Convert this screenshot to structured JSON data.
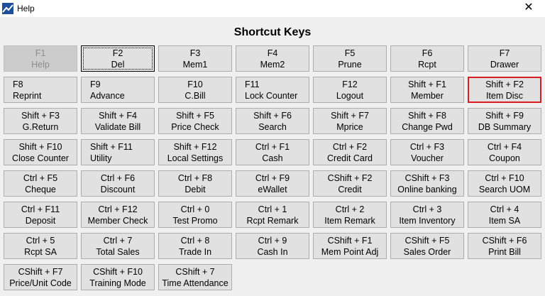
{
  "window": {
    "title": "Help",
    "close_glyph": "✕"
  },
  "heading": "Shortcut Keys",
  "keys": [
    {
      "line1": "F1",
      "line2": "Help",
      "align": "center",
      "state": "disabled"
    },
    {
      "line1": "F2",
      "line2": "Del",
      "align": "center",
      "state": "focused"
    },
    {
      "line1": "F3",
      "line2": "Mem1",
      "align": "center"
    },
    {
      "line1": "F4",
      "line2": "Mem2",
      "align": "center"
    },
    {
      "line1": "F5",
      "line2": "Prune",
      "align": "center"
    },
    {
      "line1": "F6",
      "line2": "Rcpt",
      "align": "center"
    },
    {
      "line1": "F7",
      "line2": "Drawer",
      "align": "center"
    },
    {
      "line1": "F8",
      "line2": "Reprint",
      "align": "left"
    },
    {
      "line1": "F9",
      "line2": "Advance",
      "align": "left"
    },
    {
      "line1": "F10",
      "line2": "C.Bill",
      "align": "center"
    },
    {
      "line1": "F11",
      "line2": "Lock Counter",
      "align": "left"
    },
    {
      "line1": "F12",
      "line2": "Logout",
      "align": "center"
    },
    {
      "line1": "Shift + F1",
      "line2": "Member",
      "align": "center"
    },
    {
      "line1": "Shift + F2",
      "line2": "Item Disc",
      "align": "center",
      "state": "highlight"
    },
    {
      "line1": "Shift + F3",
      "line2": "G.Return",
      "align": "center"
    },
    {
      "line1": "Shift + F4",
      "line2": "Validate Bill",
      "align": "center"
    },
    {
      "line1": "Shift + F5",
      "line2": "Price Check",
      "align": "center"
    },
    {
      "line1": "Shift + F6",
      "line2": "Search",
      "align": "center"
    },
    {
      "line1": "Shift + F7",
      "line2": "Mprice",
      "align": "center"
    },
    {
      "line1": "Shift + F8",
      "line2": "Change Pwd",
      "align": "center"
    },
    {
      "line1": "Shift + F9",
      "line2": "DB Summary",
      "align": "center"
    },
    {
      "line1": "Shift + F10",
      "line2": "Close Counter",
      "align": "center"
    },
    {
      "line1": "Shift + F11",
      "line2": "Utility",
      "align": "left"
    },
    {
      "line1": "Shift + F12",
      "line2": "Local Settings",
      "align": "center"
    },
    {
      "line1": "Ctrl + F1",
      "line2": "Cash",
      "align": "center"
    },
    {
      "line1": "Ctrl + F2",
      "line2": "Credit Card",
      "align": "center"
    },
    {
      "line1": "Ctrl + F3",
      "line2": "Voucher",
      "align": "center"
    },
    {
      "line1": "Ctrl + F4",
      "line2": "Coupon",
      "align": "center"
    },
    {
      "line1": "Ctrl + F5",
      "line2": "Cheque",
      "align": "center"
    },
    {
      "line1": "Ctrl + F6",
      "line2": "Discount",
      "align": "center"
    },
    {
      "line1": "Ctrl + F8",
      "line2": "Debit",
      "align": "center"
    },
    {
      "line1": "Ctrl + F9",
      "line2": "eWallet",
      "align": "center"
    },
    {
      "line1": "CShift + F2",
      "line2": "Credit",
      "align": "center"
    },
    {
      "line1": "CShift + F3",
      "line2": "Online banking",
      "align": "center"
    },
    {
      "line1": "Ctrl + F10",
      "line2": "Search UOM",
      "align": "center"
    },
    {
      "line1": "Ctrl + F11",
      "line2": "Deposit",
      "align": "center"
    },
    {
      "line1": "Ctrl + F12",
      "line2": "Member Check",
      "align": "center"
    },
    {
      "line1": "Ctrl + 0",
      "line2": "Test Promo",
      "align": "center"
    },
    {
      "line1": "Ctrl + 1",
      "line2": "Rcpt Remark",
      "align": "center"
    },
    {
      "line1": "Ctrl + 2",
      "line2": "Item Remark",
      "align": "center"
    },
    {
      "line1": "Ctrl + 3",
      "line2": "Item Inventory",
      "align": "center"
    },
    {
      "line1": "Ctrl + 4",
      "line2": "Item SA",
      "align": "center"
    },
    {
      "line1": "Ctrl + 5",
      "line2": "Rcpt SA",
      "align": "center"
    },
    {
      "line1": "Ctrl + 7",
      "line2": "Total Sales",
      "align": "center"
    },
    {
      "line1": "Ctrl + 8",
      "line2": "Trade In",
      "align": "center"
    },
    {
      "line1": "Ctrl + 9",
      "line2": "Cash In",
      "align": "center"
    },
    {
      "line1": "CShift + F1",
      "line2": "Mem Point Adj",
      "align": "center"
    },
    {
      "line1": "CShift + F5",
      "line2": "Sales Order",
      "align": "center"
    },
    {
      "line1": "CShift + F6",
      "line2": "Print Bill",
      "align": "center"
    },
    {
      "line1": "CShift + F7",
      "line2": "Price/Unit Code",
      "align": "center"
    },
    {
      "line1": "CShift + F10",
      "line2": "Training Mode",
      "align": "center"
    },
    {
      "line1": "CShift + 7",
      "line2": "Time Attendance",
      "align": "center"
    }
  ]
}
